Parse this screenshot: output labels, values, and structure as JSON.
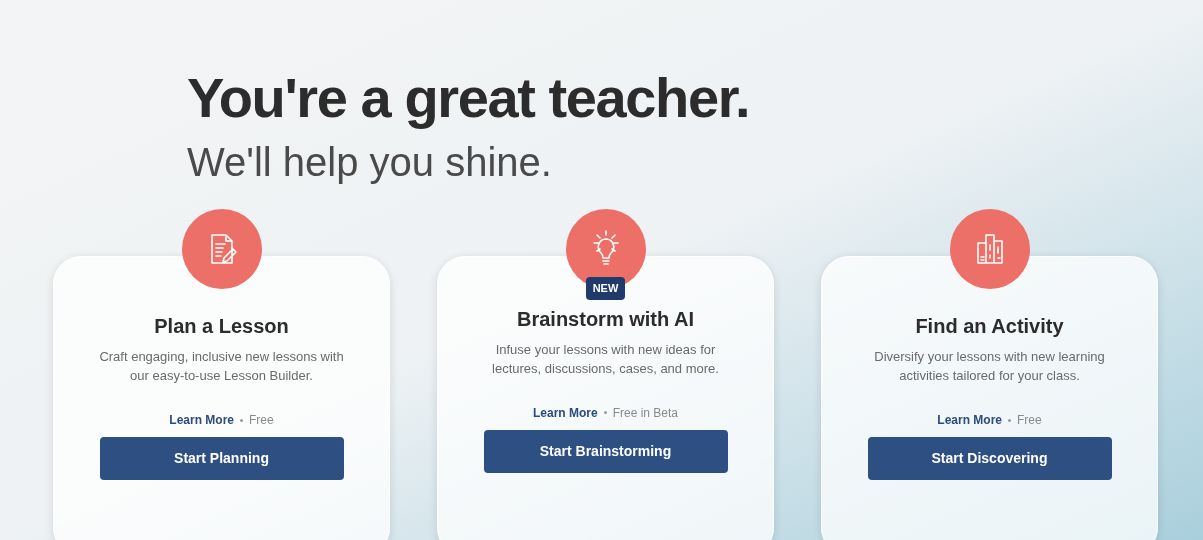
{
  "hero": {
    "headline": "You're a great teacher.",
    "subheadline": "We'll help you shine."
  },
  "cards": [
    {
      "kind": "document",
      "title": "Plan a Lesson",
      "description": "Craft engaging, inclusive new lessons with our easy-to-use Lesson Builder.",
      "link": "Learn More",
      "price": "Free",
      "button": "Start Planning"
    },
    {
      "kind": "bulb",
      "badge": "NEW",
      "title": "Brainstorm with AI",
      "description": "Infuse your lessons with new ideas for lectures, discussions, cases, and more.",
      "link": "Learn More",
      "price": "Free in Beta",
      "button": "Start Brainstorming"
    },
    {
      "kind": "books",
      "title": "Find an Activity",
      "description": "Diversify your lessons with new learning activities tailored for your class.",
      "link": "Learn More",
      "price": "Free",
      "button": "Start Discovering"
    }
  ]
}
